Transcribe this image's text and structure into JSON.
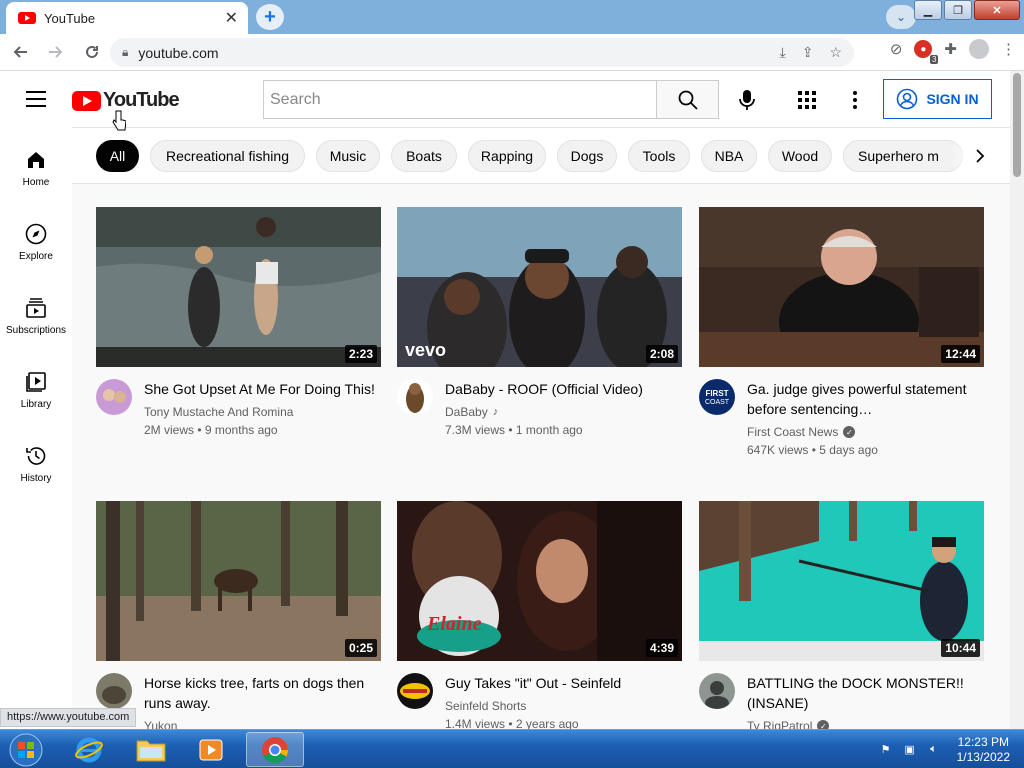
{
  "browser": {
    "tab_title": "YouTube",
    "url": "youtube.com",
    "status_url": "https://www.youtube.com",
    "ext_badge": "3"
  },
  "header": {
    "logo_text": "YouTube",
    "search_placeholder": "Search",
    "sign_in_label": "SIGN IN"
  },
  "sidebar": {
    "items": [
      {
        "label": "Home",
        "icon": "home-icon"
      },
      {
        "label": "Explore",
        "icon": "compass-icon"
      },
      {
        "label": "Subscriptions",
        "icon": "subscriptions-icon"
      },
      {
        "label": "Library",
        "icon": "library-icon"
      },
      {
        "label": "History",
        "icon": "history-icon"
      }
    ]
  },
  "chips": [
    "All",
    "Recreational fishing",
    "Music",
    "Boats",
    "Rapping",
    "Dogs",
    "Tools",
    "NBA",
    "Wood",
    "Superhero m"
  ],
  "videos": [
    {
      "title": "She Got Upset At Me For Doing This!",
      "channel": "Tony Mustache And Romina",
      "stats": "2M views • 9 months ago",
      "duration": "2:23",
      "verified": false,
      "music": false
    },
    {
      "title": "DaBaby - ROOF (Official Video)",
      "channel": "DaBaby",
      "stats": "7.3M views • 1 month ago",
      "duration": "2:08",
      "verified": false,
      "music": true,
      "watermark": "vevo"
    },
    {
      "title": "Ga. judge gives powerful statement before sentencing…",
      "channel": "First Coast News",
      "stats": "647K views • 5 days ago",
      "duration": "12:44",
      "verified": true,
      "music": false,
      "avatar_text": "FIRST COAST NEWS"
    },
    {
      "title": "Horse kicks tree, farts on dogs then runs away.",
      "channel": "Yukon",
      "stats": "",
      "duration": "0:25",
      "verified": false,
      "music": false
    },
    {
      "title": "Guy Takes \"it\" Out - Seinfeld",
      "channel": "Seinfeld Shorts",
      "stats": "1.4M views • 2 years ago",
      "duration": "4:39",
      "verified": false,
      "music": false,
      "overlay": "Elaine"
    },
    {
      "title": "BATTLING the DOCK MONSTER!! (INSANE)",
      "channel": "Ty RigPatrol",
      "stats": "",
      "duration": "10:44",
      "verified": true,
      "music": false
    }
  ],
  "taskbar": {
    "time": "12:23 PM",
    "date": "1/13/2022"
  },
  "colors": {
    "brand_red": "#ff0000",
    "link_blue": "#065fd4",
    "chip_active": "#030303"
  }
}
